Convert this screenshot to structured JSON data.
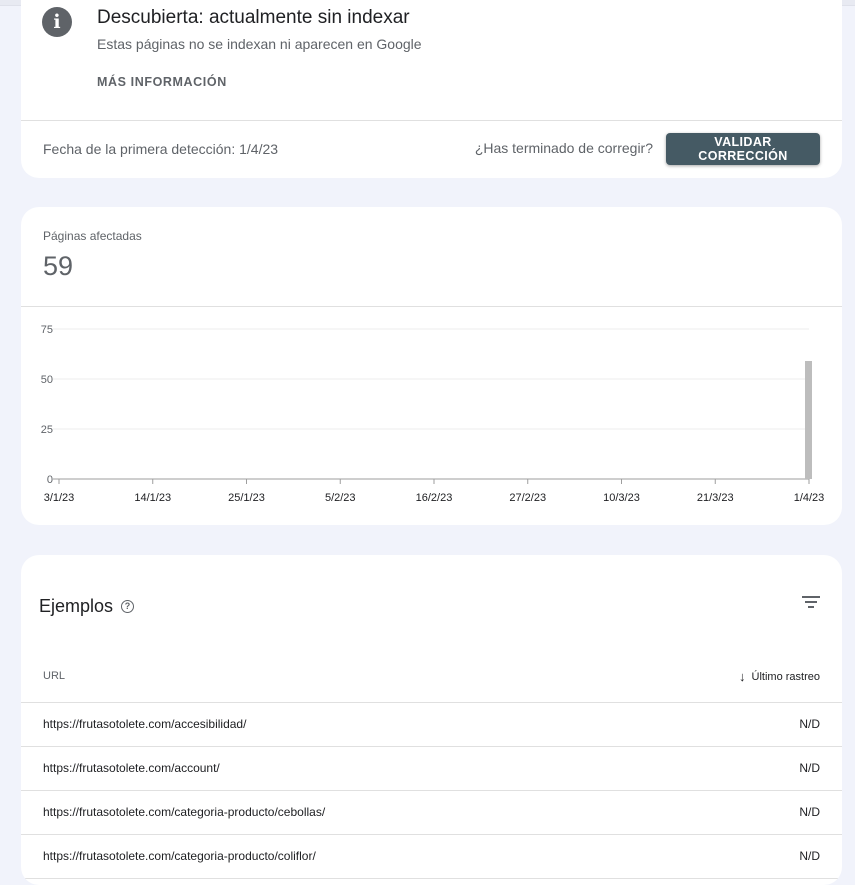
{
  "issue": {
    "icon": "info-icon",
    "title": "Descubierta: actualmente sin indexar",
    "subtitle": "Estas páginas no se indexan ni aparecen en Google",
    "more_info": "MÁS INFORMACIÓN",
    "first_detection": "Fecha de la primera detección: 1/4/23",
    "fix_question": "¿Has terminado de corregir?",
    "validate_label": "VALIDAR CORRECCIÓN",
    "accent": "#455a64"
  },
  "metric": {
    "label": "Páginas afectadas",
    "value": "59"
  },
  "chart_data": {
    "type": "bar",
    "x_ticks": [
      "3/1/23",
      "14/1/23",
      "25/1/23",
      "5/2/23",
      "16/2/23",
      "27/2/23",
      "10/3/23",
      "21/3/23",
      "1/4/23"
    ],
    "y_ticks": [
      0,
      25,
      50,
      75
    ],
    "ylim": [
      0,
      75
    ],
    "series": [
      {
        "points": [
          {
            "x": "1/4/23",
            "y": 59
          }
        ]
      }
    ],
    "grid": true,
    "bar_color": "#bdbdbd"
  },
  "examples": {
    "title": "Ejemplos",
    "help_icon": "help-circle-icon",
    "filter_icon": "filter-icon",
    "columns": {
      "url": "URL",
      "last_crawl": "Último rastreo"
    },
    "rows": [
      {
        "url": "https://frutasotolete.com/accesibilidad/",
        "last_crawl": "N/D"
      },
      {
        "url": "https://frutasotolete.com/account/",
        "last_crawl": "N/D"
      },
      {
        "url": "https://frutasotolete.com/categoria-producto/cebollas/",
        "last_crawl": "N/D"
      },
      {
        "url": "https://frutasotolete.com/categoria-producto/coliflor/",
        "last_crawl": "N/D"
      }
    ]
  }
}
